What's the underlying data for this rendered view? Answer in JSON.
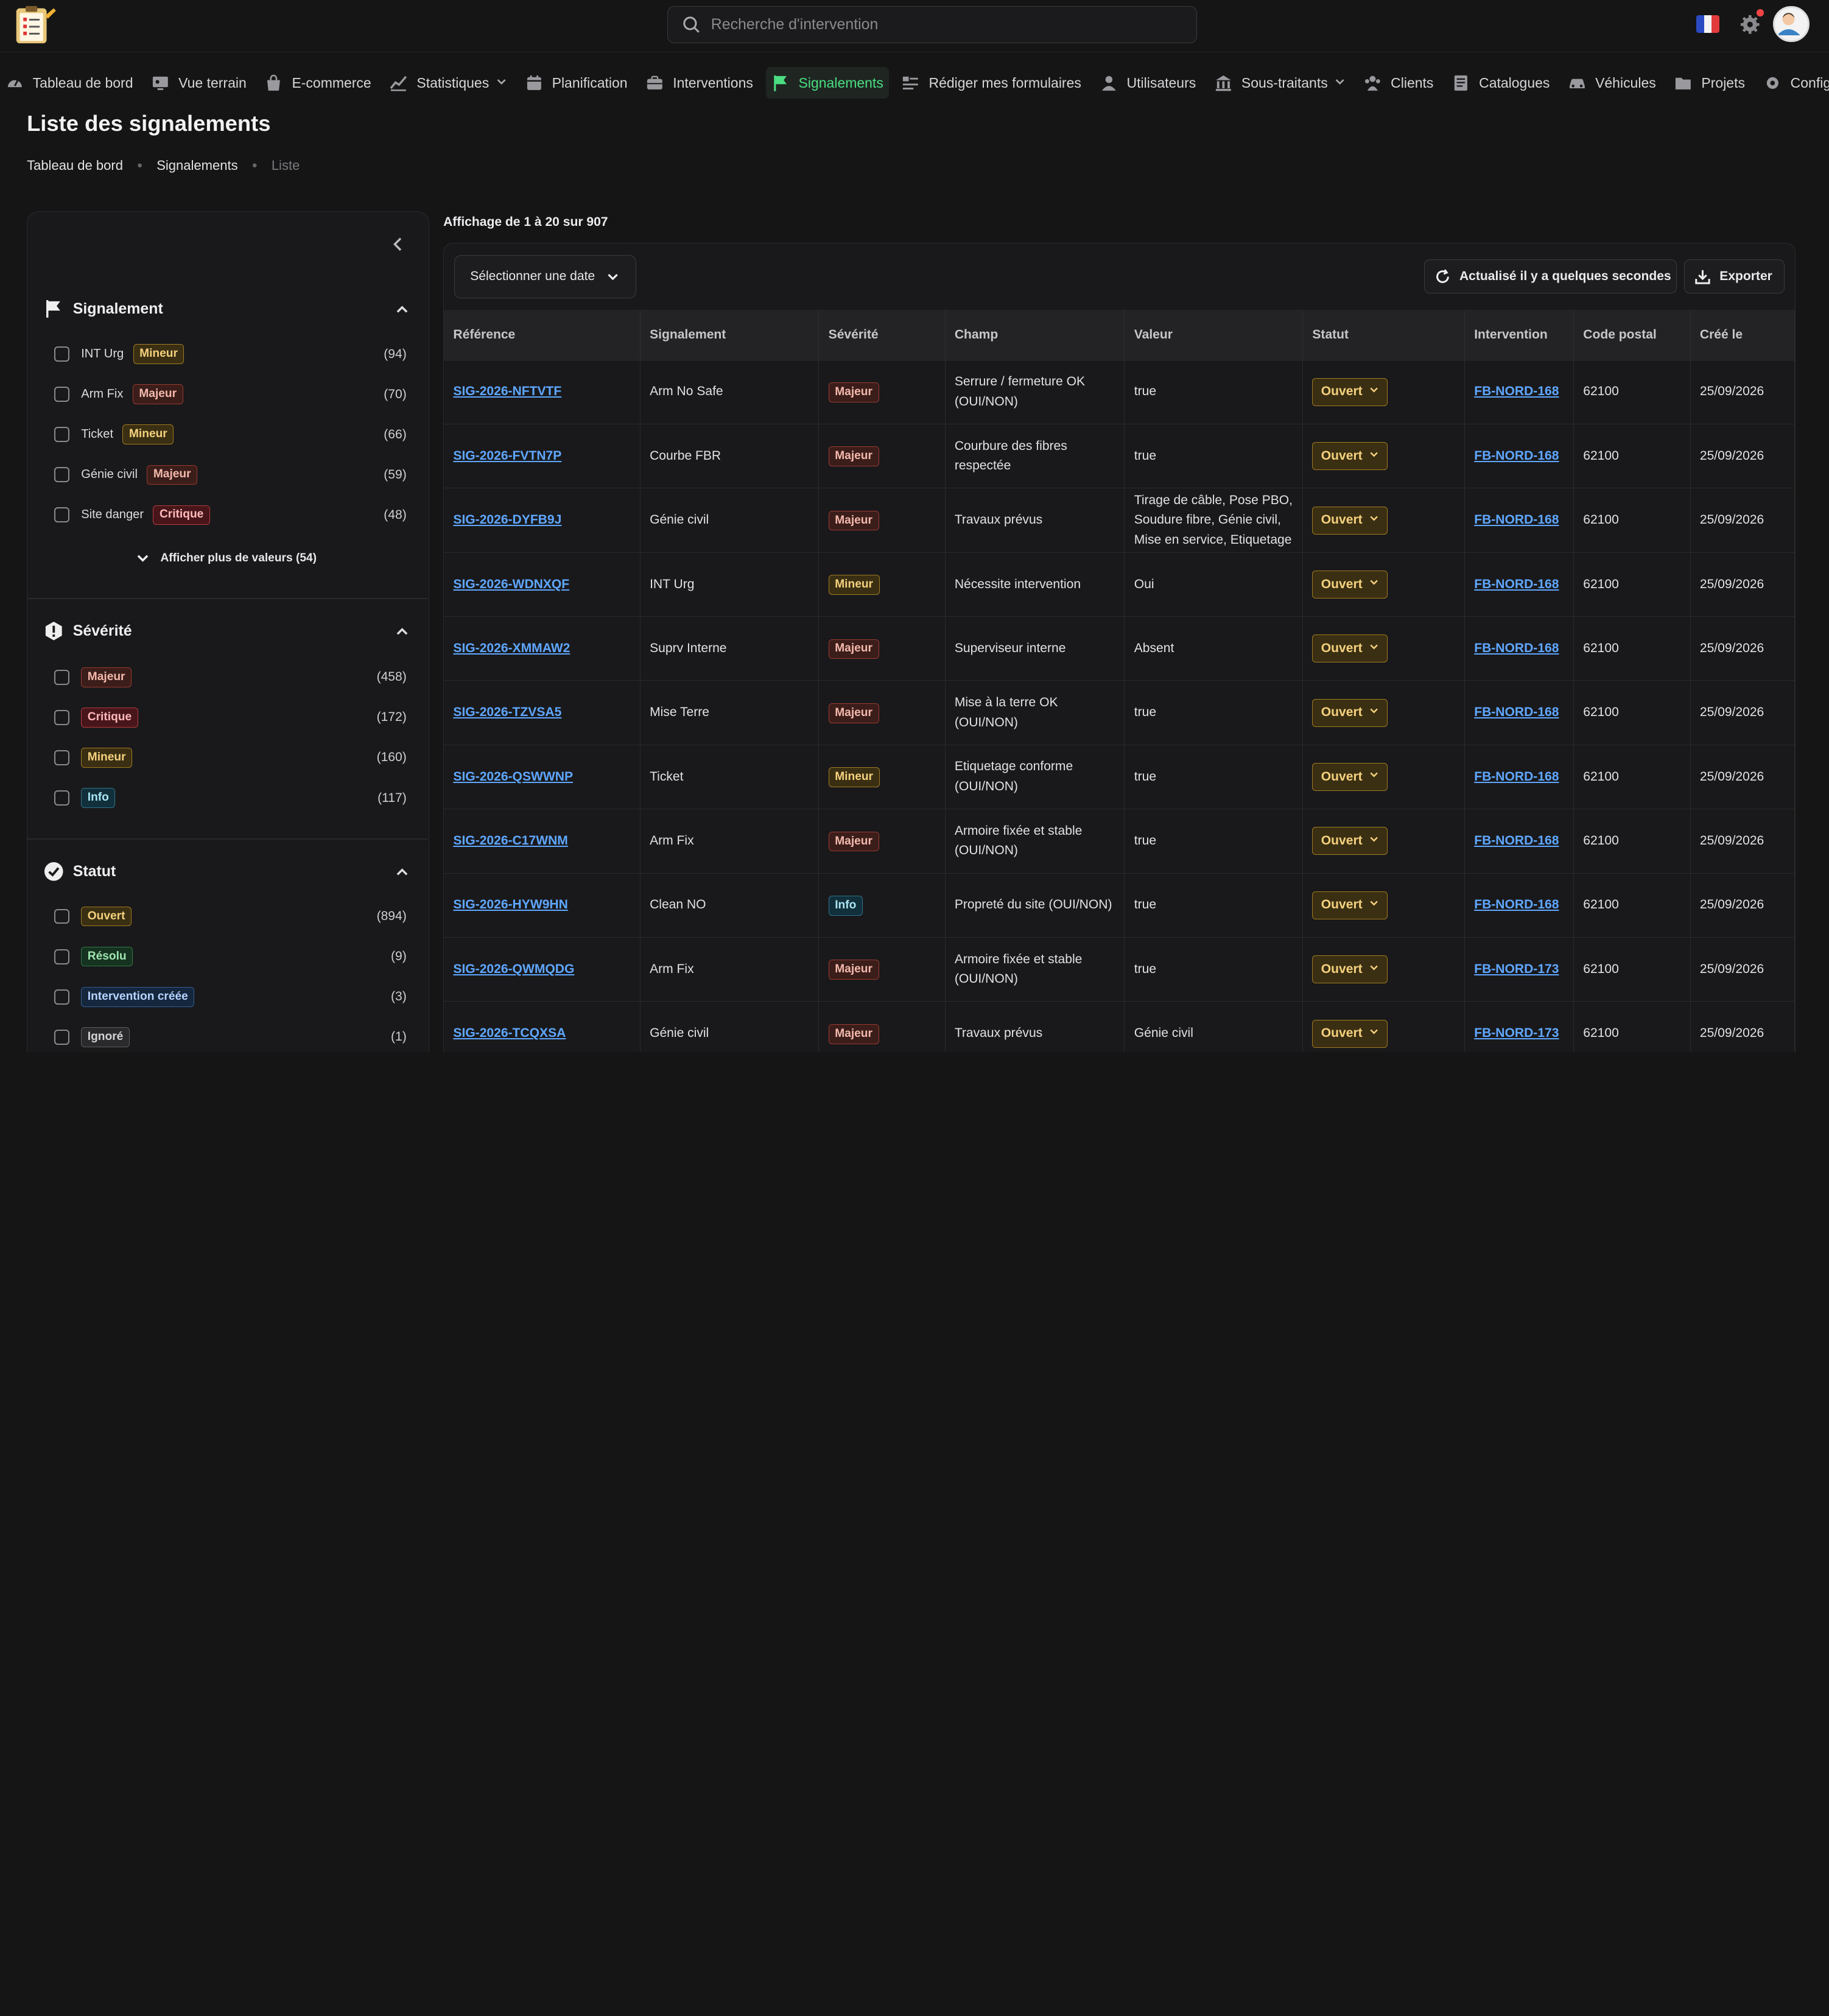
{
  "search": {
    "placeholder": "Recherche d'intervention"
  },
  "nav": [
    {
      "label": "Tableau de bord",
      "icon": "gauge-icon"
    },
    {
      "label": "Vue terrain",
      "icon": "monitor-icon"
    },
    {
      "label": "E-commerce",
      "icon": "bag-icon"
    },
    {
      "label": "Statistiques",
      "icon": "chart-icon",
      "dropdown": true
    },
    {
      "label": "Planification",
      "icon": "calendar-icon"
    },
    {
      "label": "Interventions",
      "icon": "briefcase-icon"
    },
    {
      "label": "Signalements",
      "icon": "flag-icon",
      "active": true
    },
    {
      "label": "Rédiger mes formulaires",
      "icon": "form-icon"
    },
    {
      "label": "Utilisateurs",
      "icon": "user-icon"
    },
    {
      "label": "Sous-traitants",
      "icon": "building-icon",
      "dropdown": true
    },
    {
      "label": "Clients",
      "icon": "users-icon"
    },
    {
      "label": "Catalogues",
      "icon": "book-icon"
    },
    {
      "label": "Véhicules",
      "icon": "car-icon"
    },
    {
      "label": "Projets",
      "icon": "folder-icon"
    },
    {
      "label": "Configuratio",
      "icon": "gear-icon"
    }
  ],
  "header": {
    "title": "Liste des signalements",
    "breadcrumb": [
      "Tableau de bord",
      "Signalements",
      "Liste"
    ]
  },
  "filters": {
    "signalement": {
      "title": "Signalement",
      "items": [
        {
          "label": "INT Urg",
          "badge": "Mineur",
          "count": "(94)"
        },
        {
          "label": "Arm Fix",
          "badge": "Majeur",
          "count": "(70)"
        },
        {
          "label": "Ticket",
          "badge": "Mineur",
          "count": "(66)"
        },
        {
          "label": "Génie civil",
          "badge": "Majeur",
          "count": "(59)"
        },
        {
          "label": "Site danger",
          "badge": "Critique",
          "count": "(48)"
        }
      ],
      "more": "Afficher plus de valeurs (54)"
    },
    "severite": {
      "title": "Sévérité",
      "items": [
        {
          "badge": "Majeur",
          "count": "(458)"
        },
        {
          "badge": "Critique",
          "count": "(172)"
        },
        {
          "badge": "Mineur",
          "count": "(160)"
        },
        {
          "badge": "Info",
          "count": "(117)"
        }
      ]
    },
    "statut": {
      "title": "Statut",
      "items": [
        {
          "badge": "Ouvert",
          "count": "(894)"
        },
        {
          "badge": "Résolu",
          "count": "(9)"
        },
        {
          "badge": "Intervention créée",
          "count": "(3)"
        },
        {
          "badge": "Ignoré",
          "count": "(1)"
        }
      ]
    }
  },
  "main": {
    "showing": "Affichage de 1 à 20 sur 907",
    "date_button": "Sélectionner une date",
    "refresh_button": "Actualisé il y a quelques secondes",
    "export_button": "Exporter",
    "columns": [
      "Référence",
      "Signalement",
      "Sévérité",
      "Champ",
      "Valeur",
      "Statut",
      "Intervention",
      "Code postal",
      "Créé le"
    ],
    "rows": [
      {
        "ref": "SIG-2026-NFTVTF",
        "signalement": "Arm No Safe",
        "severite": "Majeur",
        "champ": "Serrure / fermeture OK (OUI/NON)",
        "valeur": "true",
        "statut": "Ouvert",
        "intervention": "FB-NORD-168",
        "cp": "62100",
        "cree": "25/09/2026"
      },
      {
        "ref": "SIG-2026-FVTN7P",
        "signalement": "Courbe FBR",
        "severite": "Majeur",
        "champ": "Courbure des fibres respectée",
        "valeur": "true",
        "statut": "Ouvert",
        "intervention": "FB-NORD-168",
        "cp": "62100",
        "cree": "25/09/2026"
      },
      {
        "ref": "SIG-2026-DYFB9J",
        "signalement": "Génie civil",
        "severite": "Majeur",
        "champ": "Travaux prévus",
        "valeur": "Tirage de câble, Pose PBO, Soudure fibre, Génie civil, Mise en service, Etiquetage",
        "statut": "Ouvert",
        "intervention": "FB-NORD-168",
        "cp": "62100",
        "cree": "25/09/2026"
      },
      {
        "ref": "SIG-2026-WDNXQF",
        "signalement": "INT Urg",
        "severite": "Mineur",
        "champ": "Nécessite intervention",
        "valeur": "Oui",
        "statut": "Ouvert",
        "intervention": "FB-NORD-168",
        "cp": "62100",
        "cree": "25/09/2026"
      },
      {
        "ref": "SIG-2026-XMMAW2",
        "signalement": "Suprv Interne",
        "severite": "Majeur",
        "champ": "Superviseur interne",
        "valeur": "Absent",
        "statut": "Ouvert",
        "intervention": "FB-NORD-168",
        "cp": "62100",
        "cree": "25/09/2026"
      },
      {
        "ref": "SIG-2026-TZVSA5",
        "signalement": "Mise Terre",
        "severite": "Majeur",
        "champ": "Mise à la terre OK (OUI/NON)",
        "valeur": "true",
        "statut": "Ouvert",
        "intervention": "FB-NORD-168",
        "cp": "62100",
        "cree": "25/09/2026"
      },
      {
        "ref": "SIG-2026-QSWWNP",
        "signalement": "Ticket",
        "severite": "Mineur",
        "champ": "Etiquetage conforme (OUI/NON)",
        "valeur": "true",
        "statut": "Ouvert",
        "intervention": "FB-NORD-168",
        "cp": "62100",
        "cree": "25/09/2026"
      },
      {
        "ref": "SIG-2026-C17WNM",
        "signalement": "Arm Fix",
        "severite": "Majeur",
        "champ": "Armoire fixée et stable (OUI/NON)",
        "valeur": "true",
        "statut": "Ouvert",
        "intervention": "FB-NORD-168",
        "cp": "62100",
        "cree": "25/09/2026"
      },
      {
        "ref": "SIG-2026-HYW9HN",
        "signalement": "Clean NO",
        "severite": "Info",
        "champ": "Propreté du site (OUI/NON)",
        "valeur": "true",
        "statut": "Ouvert",
        "intervention": "FB-NORD-168",
        "cp": "62100",
        "cree": "25/09/2026"
      },
      {
        "ref": "SIG-2026-QWMQDG",
        "signalement": "Arm Fix",
        "severite": "Majeur",
        "champ": "Armoire fixée et stable (OUI/NON)",
        "valeur": "true",
        "statut": "Ouvert",
        "intervention": "FB-NORD-173",
        "cp": "62100",
        "cree": "25/09/2026"
      },
      {
        "ref": "SIG-2026-TCQXSA",
        "signalement": "Génie civil",
        "severite": "Majeur",
        "champ": "Travaux prévus",
        "valeur": "Génie civil",
        "statut": "Ouvert",
        "intervention": "FB-NORD-173",
        "cp": "62100",
        "cree": "25/09/2026"
      }
    ]
  },
  "colors": {
    "accent": "#4ade80",
    "link": "#5fa7ff",
    "background": "#151516"
  }
}
